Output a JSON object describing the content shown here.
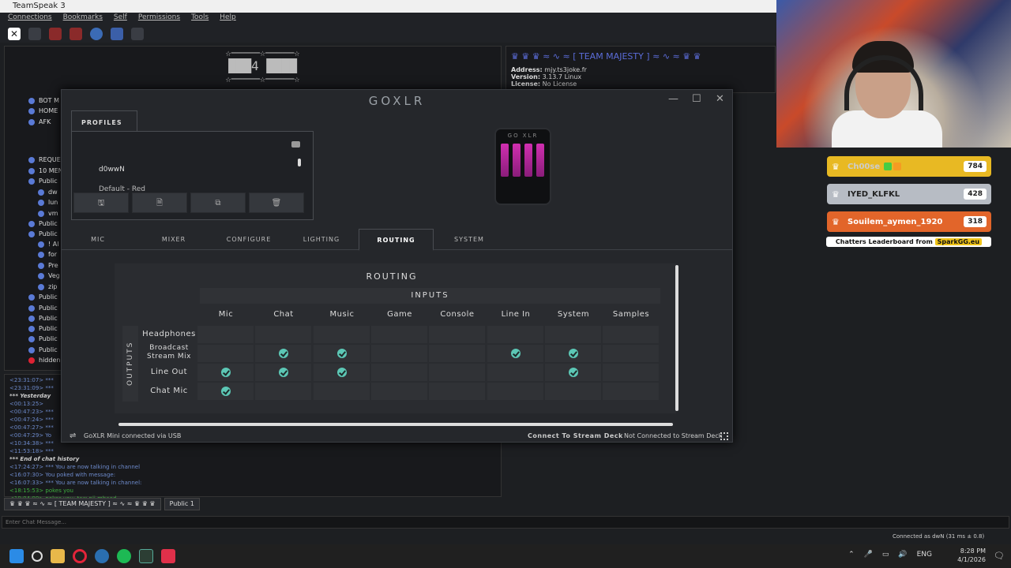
{
  "ts": {
    "title": "TeamSpeak 3",
    "menu": [
      "Connections",
      "Bookmarks",
      "Self",
      "Permissions",
      "Tools",
      "Help"
    ],
    "banner": [
      "☆─────☆─────☆",
      "███4 ████",
      "☆─────☆─────☆"
    ],
    "tree": [
      "BOT M",
      "HOME",
      "AFK",
      "REQUE",
      "10 MEN",
      "Public",
      "dw",
      "lun",
      "vm",
      "Public",
      "Public",
      "! Al",
      "for",
      "Pre",
      "Veg",
      "zip",
      "Public",
      "Public",
      "Public",
      "Public",
      "Public",
      "Public",
      "hidden"
    ],
    "server_info": {
      "name": "♛ ♛ ♛ ≈ ∿ ≈ [ TEAM MAJESTY ] ≈ ∿ ≈ ♛ ♛",
      "address_label": "Address:",
      "address": "mjy.ts3joke.fr",
      "version_label": "Version:",
      "version": "3.13.7 Linux",
      "license_label": "License:",
      "license": "No License"
    },
    "chat": [
      "<23:31:07> ***",
      "<23:31:09> ***",
      "*** Yesterday",
      "<00:13:25>",
      "<00:47:23> ***",
      "<00:47:24> ***",
      "<00:47:27> ***",
      "<00:47:29> Yo",
      "<10:34:38> ***",
      "<11:53:18> ***",
      "*** End of chat history",
      "<17:24:27> *** You are now talking in channel",
      "<16:07:30> You poked         with message:",
      "<16:07:33> *** You are now talking in channel:",
      "<18:15:53>          pokes you",
      "<19:04:00>          pokes you: taw nji mbaed"
    ],
    "tabs": [
      "♛ ♛ ♛ ≈ ∿ ≈ [ TEAM MAJESTY ] ≈ ∿ ≈ ♛ ♛ ♛",
      "Public 1"
    ],
    "chat_placeholder": "Enter Chat Message...",
    "status": "Connected as dwN (31 ms ± 0.8)"
  },
  "leaderboard": {
    "entries": [
      {
        "name": "Ch00se",
        "score": "784",
        "color": "#e8b923"
      },
      {
        "name": "IYED_KLFKL",
        "score": "428",
        "color": "#b7bcc4"
      },
      {
        "name": "Souilem_aymen_1920",
        "score": "318",
        "color": "#e2652a"
      }
    ],
    "footer": "Chatters Leaderboard from",
    "footer_brand": "SparkGG.eu"
  },
  "goxlr": {
    "title": "GoXLR",
    "profiles_tab": "PROFILES",
    "profiles": [
      "d0wwN",
      "Default - Red"
    ],
    "profile_buttons": [
      "🖫",
      "🗎",
      "⧉",
      "🗑"
    ],
    "device_logo": "GO XLR",
    "nav": [
      "MIC",
      "MIXER",
      "CONFIGURE",
      "LIGHTING",
      "ROUTING",
      "SYSTEM"
    ],
    "active_tab": "ROUTING",
    "routing": {
      "title": "ROUTING",
      "inputs_label": "INPUTS",
      "outputs_label": "OUTPUTS",
      "inputs": [
        "Mic",
        "Chat",
        "Music",
        "Game",
        "Console",
        "Line In",
        "System",
        "Samples"
      ],
      "outputs": [
        "Headphones",
        "Broadcast Stream Mix",
        "Line Out",
        "Chat Mic"
      ],
      "matrix": [
        [
          false,
          false,
          false,
          false,
          false,
          false,
          false,
          false
        ],
        [
          false,
          true,
          true,
          false,
          false,
          true,
          true,
          false
        ],
        [
          true,
          true,
          true,
          false,
          false,
          false,
          true,
          false
        ],
        [
          true,
          false,
          false,
          false,
          false,
          false,
          false,
          false
        ]
      ]
    },
    "status_left": "GoXLR Mini connected via USB",
    "connect_deck": "Connect To Stream Deck",
    "deck_status": "Not Connected to Stream Deck"
  },
  "taskbar": {
    "time": "8:28 PM",
    "date": "4/1/2026",
    "lang": "ENG"
  }
}
